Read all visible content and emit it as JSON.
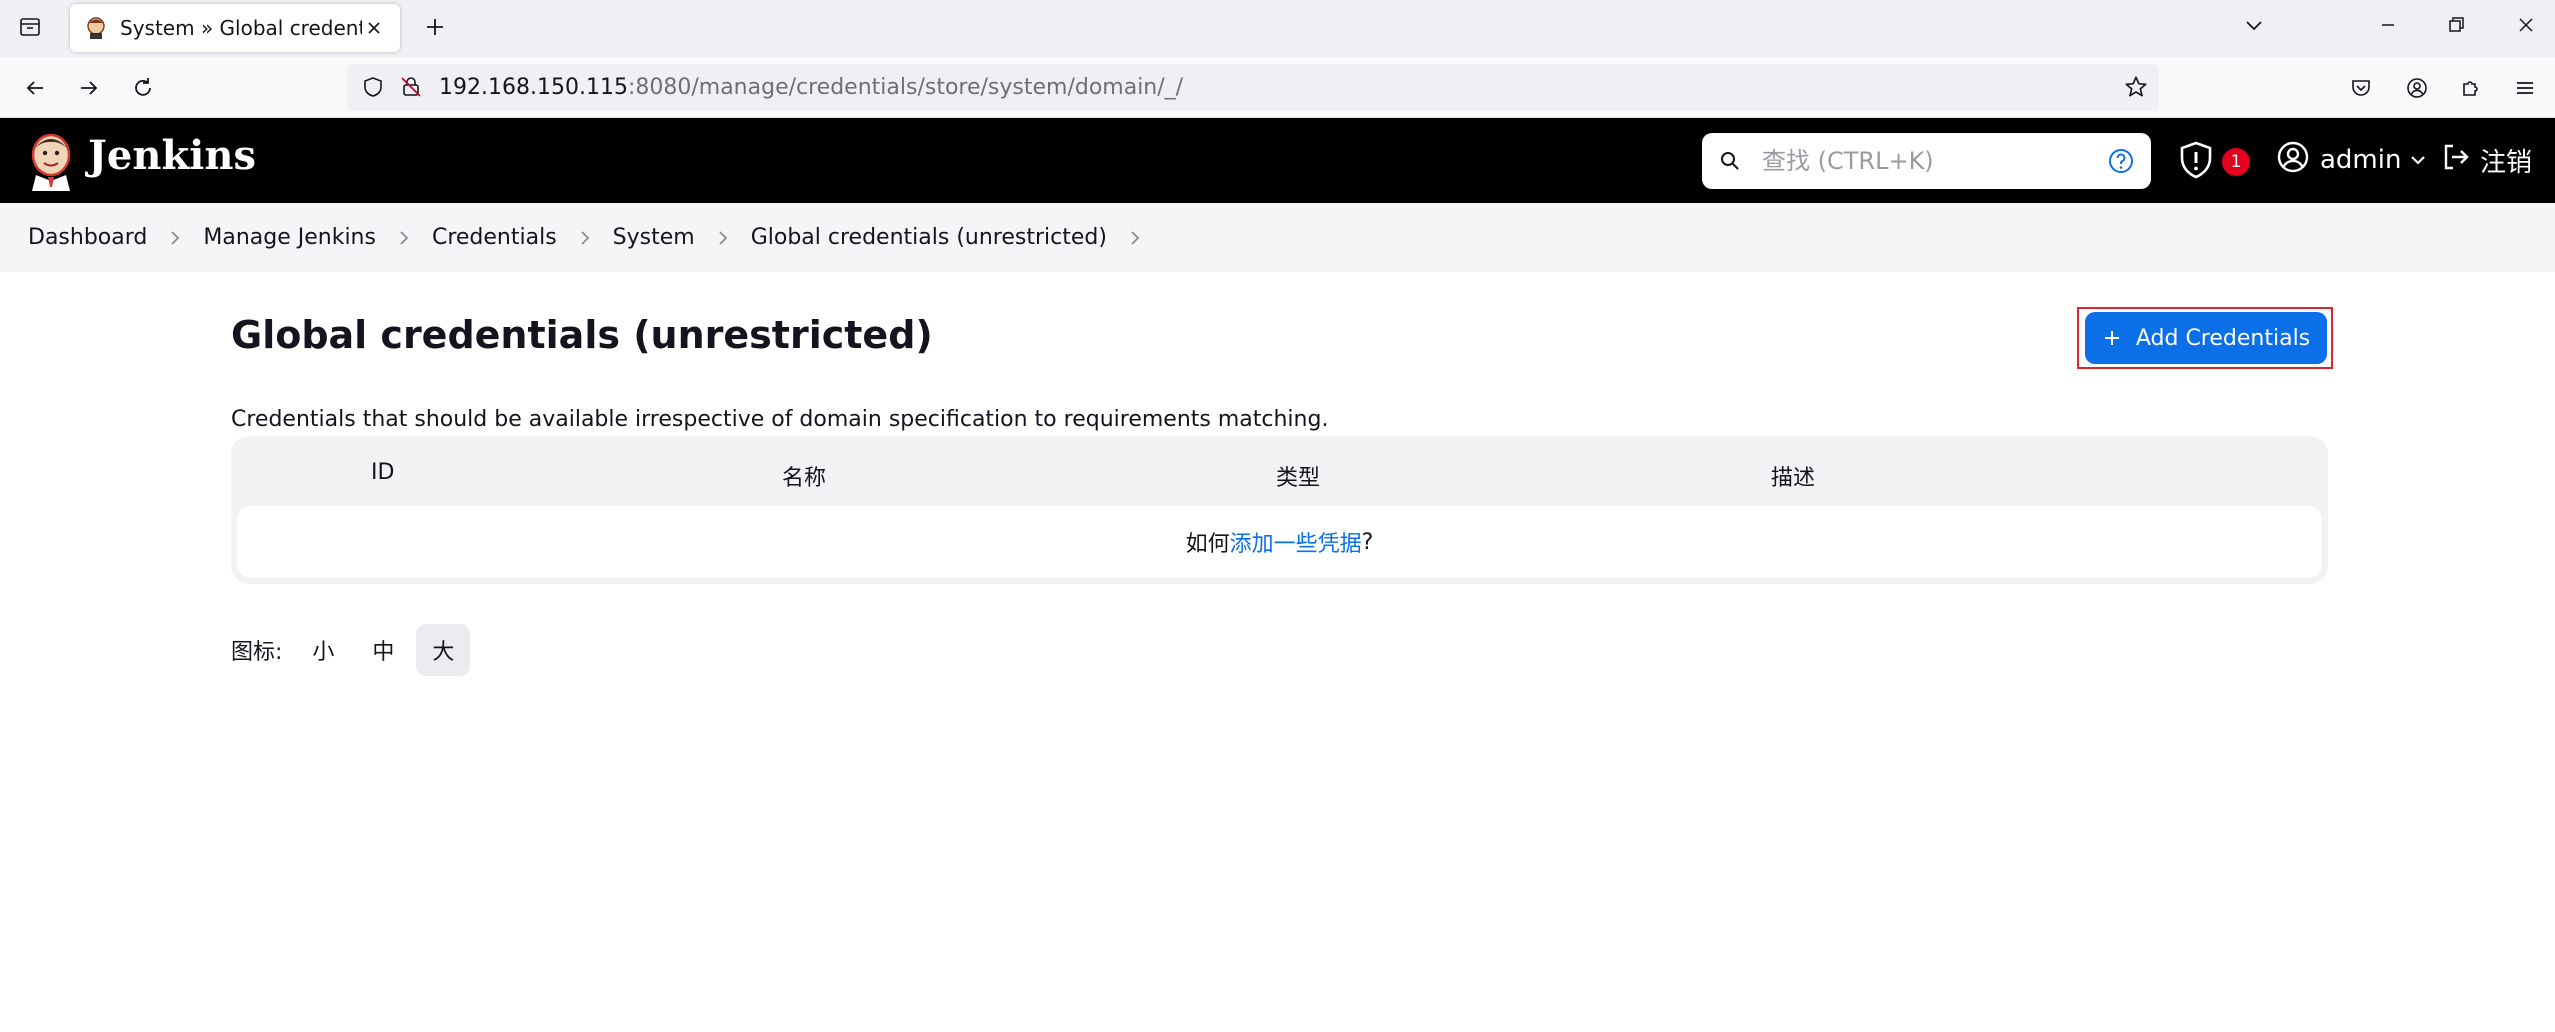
{
  "browser": {
    "tab_title": "System » Global credentials (unrestricted)",
    "url_host": "192.168.150.115",
    "url_rest": ":8080/manage/credentials/store/system/domain/_/"
  },
  "header": {
    "brand": "Jenkins",
    "search_placeholder": "查找 (CTRL+K)",
    "security_count": "1",
    "user_name": "admin",
    "logout_label": "注销"
  },
  "breadcrumb": [
    "Dashboard",
    "Manage Jenkins",
    "Credentials",
    "System",
    "Global credentials (unrestricted)"
  ],
  "main": {
    "title": "Global credentials (unrestricted)",
    "add_button": "Add Credentials",
    "description": "Credentials that should be available irrespective of domain specification to requirements matching.",
    "columns": [
      "ID",
      "名称",
      "类型",
      "描述"
    ],
    "empty_prefix": "如何",
    "empty_link": "添加一些凭据",
    "empty_suffix": "?",
    "icon_label": "图标:",
    "icon_sizes": [
      "小",
      "中",
      "大"
    ],
    "icon_size_selected": "大"
  },
  "colors": {
    "accent": "#0b6fe8",
    "header_bg": "#000000",
    "badge": "#e6001f",
    "highlight_outline": "#e0242e"
  }
}
